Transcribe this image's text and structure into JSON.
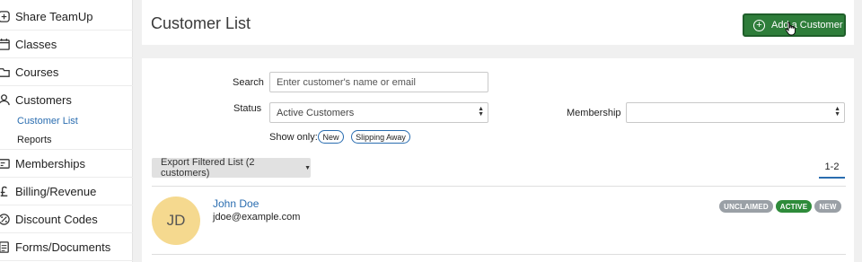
{
  "sidebar": {
    "items": [
      {
        "label": "Share TeamUp",
        "icon": "share-icon"
      },
      {
        "label": "Classes",
        "icon": "calendar-icon"
      },
      {
        "label": "Courses",
        "icon": "folder-icon"
      },
      {
        "label": "Customers",
        "icon": "user-icon"
      },
      {
        "label": "Memberships",
        "icon": "card-icon"
      },
      {
        "label": "Billing/Revenue",
        "icon": "pound-icon"
      },
      {
        "label": "Discount Codes",
        "icon": "percent-icon"
      },
      {
        "label": "Forms/Documents",
        "icon": "document-icon"
      }
    ],
    "customers_sub": [
      {
        "label": "Customer List",
        "active": true
      },
      {
        "label": "Reports",
        "active": false
      }
    ]
  },
  "header": {
    "title": "Customer List",
    "add_label": "Add a Customer"
  },
  "filters": {
    "search_label": "Search",
    "search_placeholder": "Enter customer's name or email",
    "status_label": "Status",
    "status_value": "Active Customers",
    "membership_label": "Membership",
    "membership_value": "",
    "show_only_label": "Show only:",
    "show_only_options": [
      "New",
      "Slipping Away"
    ]
  },
  "export_label": "Export Filtered List (2 customers)",
  "pager": "1-2",
  "customers": [
    {
      "initials": "JD",
      "name": "John Doe",
      "email": "jdoe@example.com",
      "badges": [
        "UNCLAIMED",
        "ACTIVE",
        "NEW"
      ]
    }
  ],
  "colors": {
    "primary_green": "#2e7d3a",
    "link_blue": "#2a6db0",
    "badge_gray": "#9aa0a6",
    "badge_green": "#2e8b3a",
    "avatar_bg": "#f5d98f"
  }
}
